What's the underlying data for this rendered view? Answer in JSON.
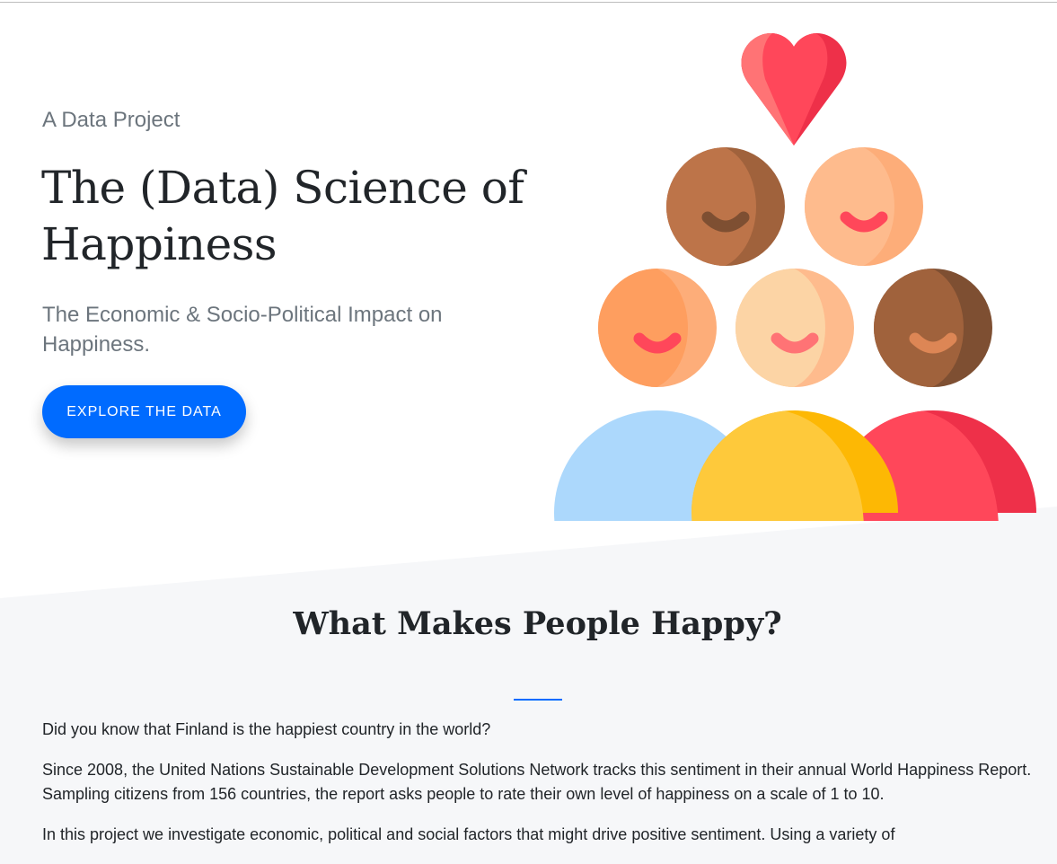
{
  "hero": {
    "eyebrow": "A Data Project",
    "title": "The (Data) Science of Happiness",
    "subtitle": "The Economic & Socio-Political Impact on Happiness.",
    "cta_label": "EXPLORE THE DATA"
  },
  "section": {
    "heading": "What Makes People Happy?",
    "paragraphs": [
      "Did you know that Finland is the happiest country in the world?",
      "Since 2008, the United Nations Sustainable Development Solutions Network tracks this sentiment in their annual World Happiness Report. Sampling citizens from 156 countries, the report asks people to rate their own level of happiness on a scale of 1 to 10.",
      "In this project we investigate economic, political and social factors that might drive positive sentiment. Using a variety of"
    ]
  },
  "colors": {
    "accent": "#006bff",
    "section_bg": "#f6f7f9",
    "heart": "#ff475a"
  }
}
